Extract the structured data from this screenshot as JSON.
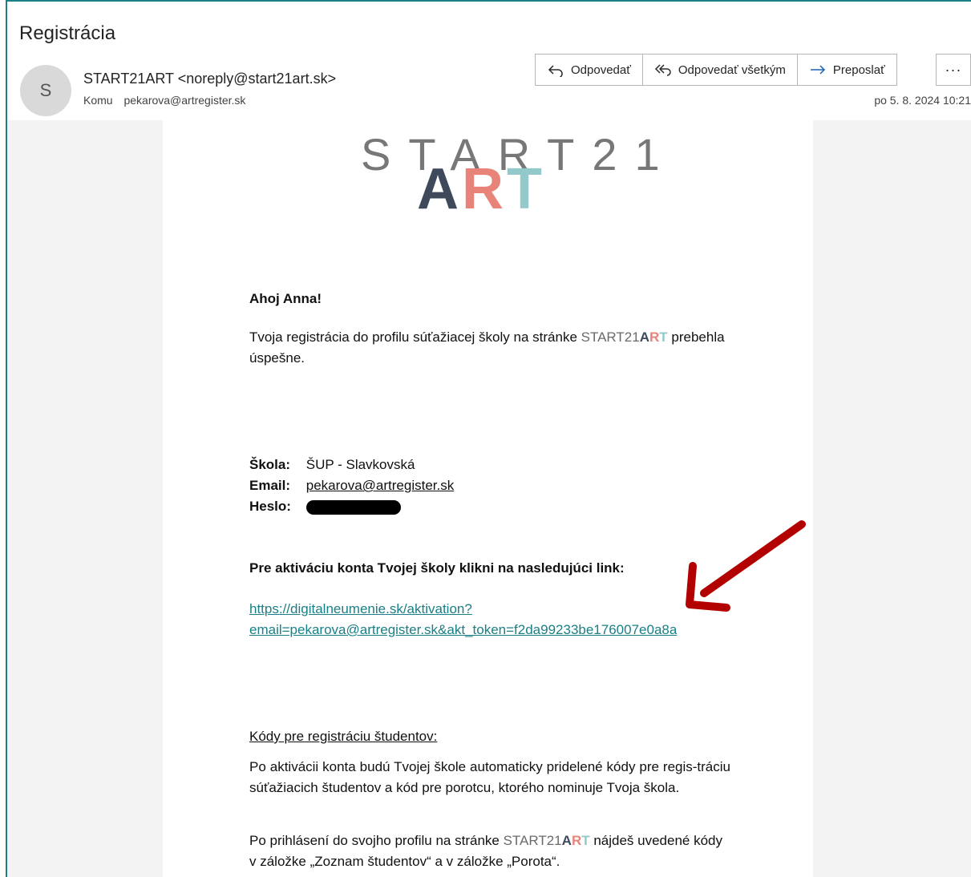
{
  "email": {
    "subject": "Registrácia",
    "avatar_initial": "S",
    "sender": "START21ART <noreply@start21art.sk>",
    "to_label": "Komu",
    "to_address": "pekarova@artregister.sk",
    "date": "po 5. 8. 2024 10:21"
  },
  "toolbar": {
    "reply_label": "Odpovedať",
    "reply_all_label": "Odpovedať všetkým",
    "forward_label": "Preposlať",
    "more_label": "···"
  },
  "logo": {
    "top": "START21",
    "a": "A",
    "r": "R",
    "t": "T"
  },
  "body": {
    "greeting": "Ahoj Anna!",
    "intro_before": "Tvoja registrácia do profilu súťažiacej školy na stránke ",
    "brand_start": "START21",
    "brand_a": "A",
    "brand_r": "R",
    "brand_t": "T",
    "intro_after": " prebehla úspešne.",
    "school_label": "Škola:",
    "school_value": "ŠUP - Slavkovská",
    "email_label": "Email:",
    "email_value": "pekarova@artregister.sk",
    "password_label": "Heslo:",
    "activation_heading": "Pre aktiváciu konta Tvojej školy klikni na nasledujúci link:",
    "activation_link_line1": "https://digitalneumenie.sk/aktivation?",
    "activation_link_line2": "email=pekarova@artregister.sk&akt_token=f2da99233be176007e0a8a",
    "codes_heading": "Kódy pre registráciu študentov:",
    "codes_paragraph": "Po aktivácii konta budú Tvojej škole automaticky pridelené kódy pre regis-tráciu súťažiacich študentov a kód pre porotcu, ktorého nominuje Tvoja škola.",
    "login_before": "Po prihlásení do svojho profilu na stránke ",
    "login_after": " nájdeš uvedené kódy v záložke „Zoznam študentov“ a v záložke „Porota“."
  },
  "colors": {
    "accent": "#1a7f86",
    "arrow": "#b30000",
    "logo_dark": "#3e4a5c",
    "logo_coral": "#e8837a",
    "logo_teal": "#93c9cb"
  }
}
